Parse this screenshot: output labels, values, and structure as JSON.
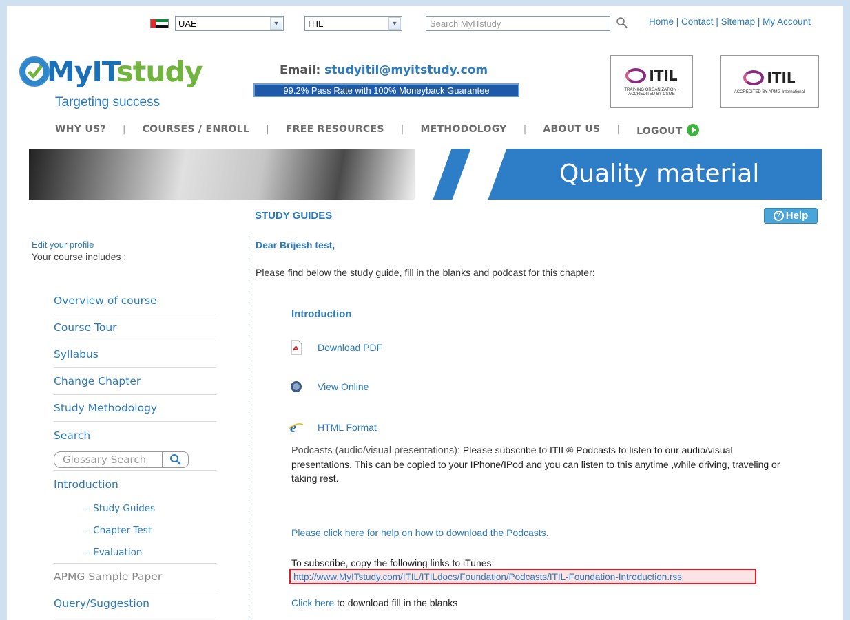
{
  "top": {
    "country": "UAE",
    "course": "ITIL",
    "search_placeholder": "Search MyITstudy",
    "links": [
      "Home",
      "Contact",
      "Sitemap",
      "My Account"
    ]
  },
  "brand": {
    "logo_my": "MyIT",
    "logo_study": "study",
    "tagline": "Targeting success",
    "email_label": "Email: ",
    "email": "studyitil@myitstudy.com",
    "pass_banner": "99.2% Pass Rate with 100% Moneyback Guarantee",
    "badge1_mark": "ITIL",
    "badge1_sub": "TRAINING ORGANIZATION · ACCREDITED BY CSME",
    "badge2_mark": "ITIL",
    "badge2_sub": "ACCREDITED BY APMG-International"
  },
  "nav": [
    "WHY US?",
    "COURSES / ENROLL",
    "FREE RESOURCES",
    "METHODOLOGY",
    "ABOUT US",
    "LOGOUT"
  ],
  "banner": {
    "caption": "Quality material"
  },
  "section_title": "STUDY GUIDES",
  "help_label": "Help",
  "sidebar": {
    "edit_profile": "Edit your profile",
    "course_includes": "Your course includes :",
    "items": [
      "Overview of course",
      "Course Tour",
      "Syllabus",
      "Change Chapter",
      "Study Methodology",
      "Search"
    ],
    "glossary_placeholder": "Glossary Search",
    "introduction": "Introduction",
    "sub_items": [
      "- Study Guides",
      "- Chapter Test",
      "- Evaluation"
    ],
    "apmg": "APMG Sample Paper",
    "query": "Query/Suggestion"
  },
  "main": {
    "greeting": "Dear Brijesh test,",
    "intro": "Please find below the study guide, fill in the blanks and podcast for this chapter:",
    "chapter": "Introduction",
    "download_pdf": "Download PDF",
    "view_online": "View Online",
    "html_format": "HTML Format",
    "podcast_lead": "Podcasts (audio/visual presentations):",
    "podcast_text": " Please subscribe to ITIL® Podcasts to listen to our audio/visual presentations. This can be copied to your IPhone/IPod and you can listen to this anytime ,while driving, traveling or taking rest.",
    "podcast_help": "Please click here for help on how to download the Podcasts.",
    "subscribe_text": "To subscribe, copy the following links to iTunes:",
    "rss_link": "http://www.MyITstudy.com/ITIL/ITILdocs/Foundation/Podcasts/ITIL-Foundation-Introduction.rss",
    "click_here": "Click here",
    "fill_blanks": " to download fill in the blanks"
  },
  "colors": {
    "accent": "#2b7bbd",
    "brand_green": "#71b53f",
    "highlight_border": "#e21c2a"
  }
}
